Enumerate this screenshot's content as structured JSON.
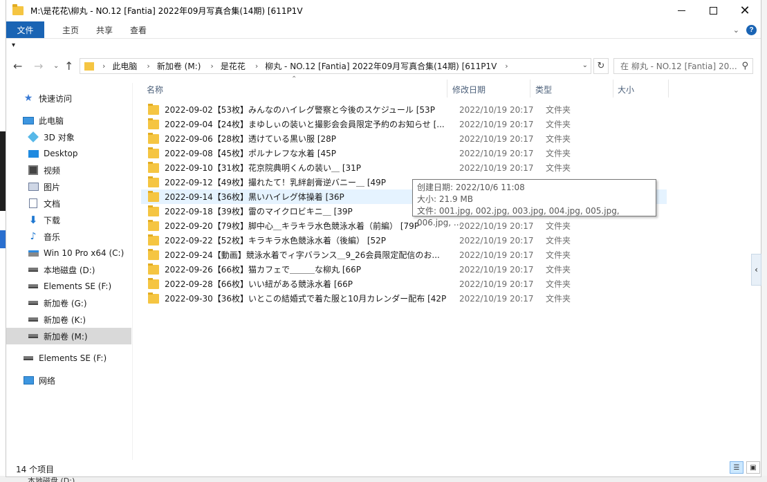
{
  "window": {
    "title": "M:\\是花花\\柳丸 - NO.12 [Fantia] 2022年09月写真合集(14期) [611P1V"
  },
  "ribbon": {
    "tabs": [
      "文件",
      "主页",
      "共享",
      "查看"
    ]
  },
  "address": {
    "crumbs": [
      "此电脑",
      "新加卷 (M:)",
      "是花花",
      "柳丸 - NO.12 [Fantia] 2022年09月写真合集(14期) [611P1V"
    ],
    "search_placeholder": "在 柳丸 - NO.12 [Fantia] 20..."
  },
  "sidebar": {
    "items": [
      {
        "label": "快速访问",
        "icon": "star-icon"
      },
      {
        "label": "此电脑",
        "icon": "computer-icon"
      },
      {
        "label": "3D 对象",
        "icon": "cube-icon"
      },
      {
        "label": "Desktop",
        "icon": "desktop-icon"
      },
      {
        "label": "视频",
        "icon": "video-icon"
      },
      {
        "label": "图片",
        "icon": "picture-icon"
      },
      {
        "label": "文档",
        "icon": "document-icon"
      },
      {
        "label": "下载",
        "icon": "download-icon"
      },
      {
        "label": "音乐",
        "icon": "music-icon"
      },
      {
        "label": "Win 10 Pro x64 (C:)",
        "icon": "windows-drive-icon"
      },
      {
        "label": "本地磁盘 (D:)",
        "icon": "drive-icon"
      },
      {
        "label": "Elements SE (F:)",
        "icon": "drive-icon"
      },
      {
        "label": "新加卷 (G:)",
        "icon": "drive-icon"
      },
      {
        "label": "新加卷 (K:)",
        "icon": "drive-icon"
      },
      {
        "label": "新加卷 (M:)",
        "icon": "drive-icon"
      },
      {
        "label": "Elements SE (F:)",
        "icon": "drive-icon"
      },
      {
        "label": "网络",
        "icon": "network-icon"
      }
    ]
  },
  "columns": {
    "name": "名称",
    "date": "修改日期",
    "type": "类型",
    "size": "大小"
  },
  "files": [
    {
      "name": "2022-09-02【53枚】みんなのハイレグ警察と今後のスケジュール [53P",
      "date": "2022/10/19 20:17",
      "type": "文件夹"
    },
    {
      "name": "2022-09-04【24枚】まゆしぃの装いと撮影会会員限定予約のお知らせ [...",
      "date": "2022/10/19 20:17",
      "type": "文件夹"
    },
    {
      "name": "2022-09-06【28枚】透けている黒い服 [28P",
      "date": "2022/10/19 20:17",
      "type": "文件夹"
    },
    {
      "name": "2022-09-08【45枚】ポルナレフな水着 [45P",
      "date": "2022/10/19 20:17",
      "type": "文件夹"
    },
    {
      "name": "2022-09-10【31枚】花京院典明くんの装い＿ [31P",
      "date": "2022/10/19 20:17",
      "type": "文件夹"
    },
    {
      "name": "2022-09-12【49枚】撮れたて！乳絆創膏逆バニー＿ [49P",
      "date": "",
      "type": ""
    },
    {
      "name": "2022-09-14【36枚】黒いハイレグ体操着 [36P",
      "date": "",
      "type": ""
    },
    {
      "name": "2022-09-18【39枚】雷のマイクロビキニ＿ [39P",
      "date": "",
      "type": ""
    },
    {
      "name": "2022-09-20【79枚】脚中心＿キラキラ水色競泳水着（前編） [79P",
      "date": "2022/10/19 20:17",
      "type": "文件夹"
    },
    {
      "name": "2022-09-22【52枚】キラキラ水色競泳水着（後編） [52P",
      "date": "2022/10/19 20:17",
      "type": "文件夹"
    },
    {
      "name": "2022-09-24【動画】競泳水着でィ字バランス＿9_26会員限定配信のお...",
      "date": "2022/10/19 20:17",
      "type": "文件夹"
    },
    {
      "name": "2022-09-26【66枚】猫カフェで＿＿＿な柳丸 [66P",
      "date": "2022/10/19 20:17",
      "type": "文件夹"
    },
    {
      "name": "2022-09-28【66枚】いい紐がある競泳水着 [66P",
      "date": "2022/10/19 20:17",
      "type": "文件夹"
    },
    {
      "name": "2022-09-30【36枚】いとこの結婚式で着た服と10月カレンダー配布 [42P",
      "date": "2022/10/19 20:17",
      "type": "文件夹"
    }
  ],
  "tooltip": {
    "created": "创建日期: 2022/10/6 11:08",
    "size": "大小: 21.9 MB",
    "files": "文件: 001.jpg, 002.jpg, 003.jpg, 004.jpg, 005.jpg, 006.jpg, ..."
  },
  "status": {
    "count": "14 个项目"
  },
  "background": {
    "peek_text": "本地磁盘 (D:)"
  },
  "colors": {
    "accent": "#1a64b4",
    "folder": "#f5c542",
    "hover": "#e5f3ff",
    "selected_sidebar": "#d9d9d9"
  }
}
